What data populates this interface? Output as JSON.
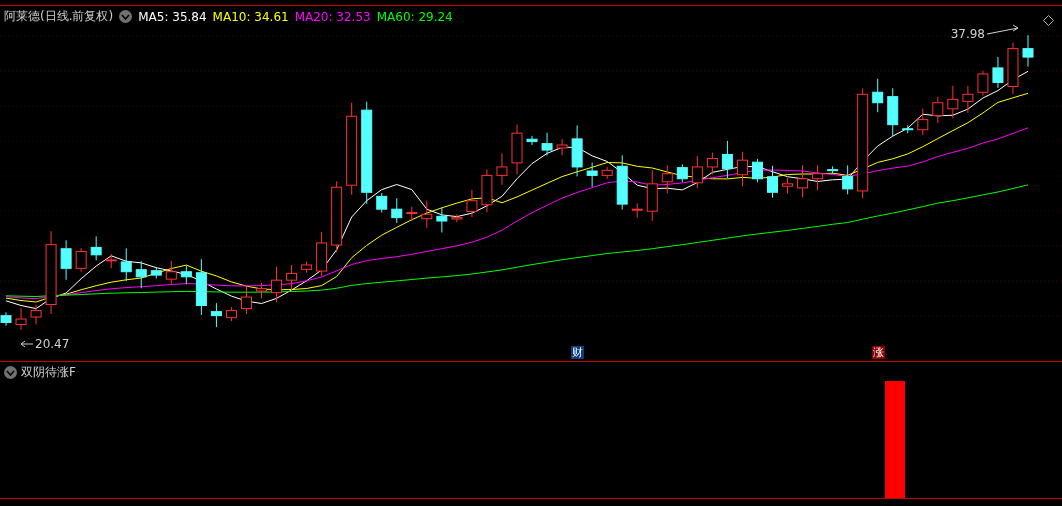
{
  "stock_legend": {
    "title": "阿莱德(日线.前复权)",
    "ma": [
      {
        "label": "MA5: 35.84",
        "color": "#ffffff"
      },
      {
        "label": "MA10: 34.61",
        "color": "#ffff00"
      },
      {
        "label": "MA20: 32.53",
        "color": "#ff00ff"
      },
      {
        "label": "MA60: 29.24",
        "color": "#00ff00"
      }
    ]
  },
  "price_labels": {
    "high": "37.98",
    "low": "20.47"
  },
  "event_markers": [
    {
      "text": "财",
      "color": "#0b3d7a"
    },
    {
      "text": "涨",
      "color": "#8b0000"
    }
  ],
  "indicator": {
    "title": "双阴待涨F"
  }
}
